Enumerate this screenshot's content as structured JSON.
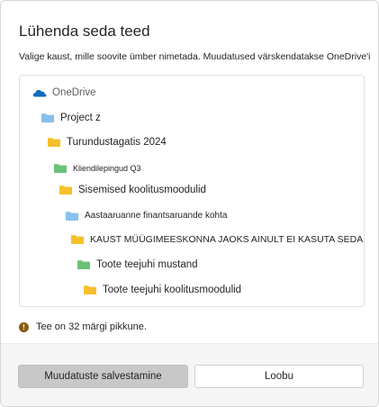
{
  "dialog": {
    "title": "Lühenda seda teed",
    "subtitle": "Valige kaust, mille soovite ümber nimetada. Muudatused värskendatakse OneDrive'is."
  },
  "tree": {
    "root_label": "OneDrive",
    "items": [
      {
        "label": "Project z",
        "color": "#86c0ef"
      },
      {
        "label": "Turundustagatis 2024",
        "color": "#f5c02b"
      },
      {
        "label": "Kliendilepingud Q3",
        "color": "#6cc17a"
      },
      {
        "label": "Sisemised koolitusmoodulid",
        "color": "#f5c02b"
      },
      {
        "label": "Aastaaruanne finantsaruande kohta",
        "color": "#86c0ef"
      },
      {
        "label": "KAUST MÜÜGIMEESKONNA JAOKS AINULT EI KASUTA SEDA",
        "color": "#f5c02b"
      },
      {
        "label": "Toote teejuhi mustand",
        "color": "#6cc17a"
      },
      {
        "label": "Toote teejuhi koolitusmoodulid",
        "color": "#f5c02b"
      }
    ]
  },
  "warning": {
    "text": "Tee on 32 märgi pikkune."
  },
  "footer": {
    "save_label": "Muudatuste salvestamine",
    "cancel_label": "Loobu"
  },
  "colors": {
    "onedrive_cloud": "#0f6cbd",
    "warning_icon": "#8a5a14",
    "primary_disabled": "#c8c8c8"
  }
}
